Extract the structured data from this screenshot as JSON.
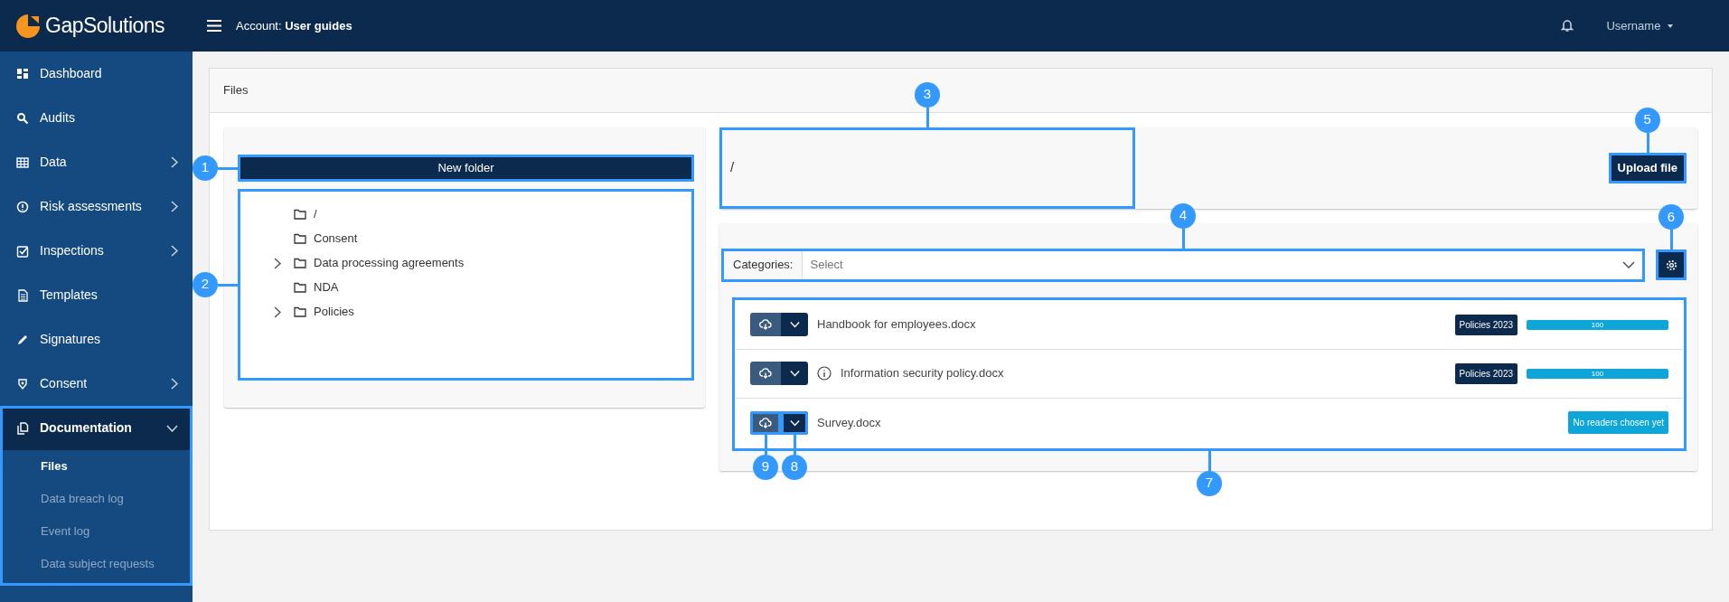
{
  "header": {
    "logo": "**Gap**Solutions",
    "account": "Account: **User guides**",
    "user": "Username"
  },
  "sidebar": {
    "items": [
      {
        "label": "Dashboard",
        "expandable": false,
        "expanded": false,
        "highlighted": false
      },
      {
        "label": "Audits",
        "expandable": false,
        "expanded": false,
        "highlighted": false
      },
      {
        "label": "Data",
        "expandable": true,
        "expanded": false,
        "highlighted": false
      },
      {
        "label": "Risk assessments",
        "expandable": true,
        "expanded": false,
        "highlighted": false
      },
      {
        "label": "Inspections",
        "expandable": true,
        "expanded": false,
        "highlighted": false
      },
      {
        "label": "Templates",
        "expandable": false,
        "expanded": false,
        "highlighted": false
      },
      {
        "label": "Signatures",
        "expandable": false,
        "expanded": false,
        "highlighted": false
      },
      {
        "label": "Consent",
        "expandable": true,
        "expanded": false,
        "highlighted": false
      },
      {
        "label": "Documentation",
        "expandable": true,
        "expanded": true,
        "highlighted": true,
        "children": [
          {
            "label": "Files",
            "selected": true
          },
          {
            "label": "Data breach log",
            "selected": false
          },
          {
            "label": "Event log",
            "selected": false
          },
          {
            "label": "Data subject requests",
            "selected": false
          }
        ]
      }
    ]
  },
  "card": {
    "title": "Files"
  },
  "new_folder_button": {
    "label": "New folder",
    "callout": "1"
  },
  "folder_tree": {
    "callout": "2",
    "items": [
      {
        "label": "/",
        "expandable": false,
        "expanded": false
      },
      {
        "label": "Consent",
        "expandable": false,
        "expanded": false
      },
      {
        "label": "Data processing agreements",
        "expandable": true,
        "expanded": false
      },
      {
        "label": "NDA",
        "expandable": false,
        "expanded": false
      },
      {
        "label": "Policies",
        "expandable": true,
        "expanded": false
      }
    ]
  },
  "path": {
    "text": "/",
    "callout": "3"
  },
  "upload_button": {
    "label": "Upload file",
    "callout": "5"
  },
  "categories": {
    "label": "Categories:",
    "placeholder": "Select",
    "callout": "4"
  },
  "settings_button": {
    "callout": "6"
  },
  "file_list": {
    "callout": "7",
    "rows": [
      {
        "name": "Handbook for employees.docx",
        "info": false,
        "tag": "Policies 2023",
        "kind": "progress",
        "level": 1,
        "reading": "100"
      },
      {
        "name": "Information security policy.docx",
        "info": true,
        "tag": "Policies 2023",
        "kind": "progress",
        "level": 1,
        "reading": "100"
      },
      {
        "name": "Survey.docx",
        "info": false,
        "kind": "status",
        "status": "No readers chosen yet",
        "download_callout": "9",
        "menu_callout": "8"
      }
    ]
  }
}
